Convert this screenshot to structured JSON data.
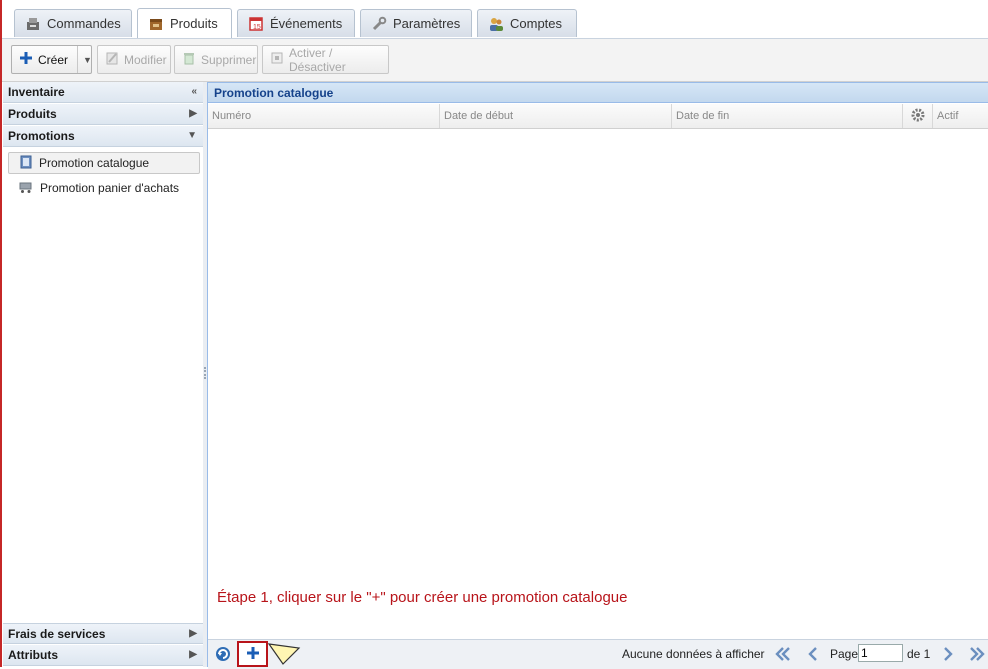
{
  "tabs": [
    {
      "label": "Commandes",
      "icon": "register-icon"
    },
    {
      "label": "Produits",
      "icon": "box-icon",
      "active": true
    },
    {
      "label": "Événements",
      "icon": "calendar-icon"
    },
    {
      "label": "Paramètres",
      "icon": "wrench-icon"
    },
    {
      "label": "Comptes",
      "icon": "users-icon"
    }
  ],
  "toolbar": {
    "create": "Créer",
    "modify": "Modifier",
    "delete": "Supprimer",
    "toggle": "Activer / Désactiver"
  },
  "sidebar": {
    "inventory": "Inventaire",
    "products": "Produits",
    "promotions": "Promotions",
    "items": [
      "Promotion catalogue",
      "Promotion panier d'achats"
    ],
    "fees": "Frais de services",
    "attributes": "Attributs"
  },
  "panel": {
    "title": "Promotion catalogue",
    "columns": [
      "Numéro",
      "Date de début",
      "Date de fin",
      "Actif"
    ]
  },
  "annotation": "Étape 1, cliquer sur le \"+\" pour créer une promotion catalogue",
  "pager": {
    "empty_text": "Aucune données à afficher",
    "page_label": "Page",
    "page_value": "1",
    "of_label": "de 1"
  },
  "colors": {
    "accent": "#15428b",
    "annotation": "#b8141a"
  }
}
